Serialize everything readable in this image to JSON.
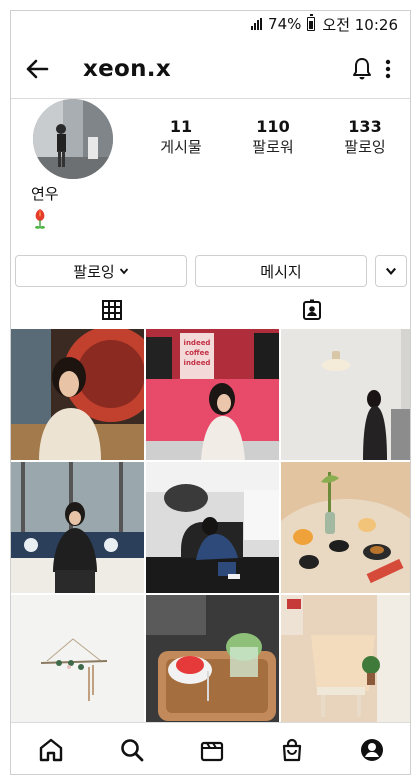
{
  "status_bar": {
    "battery": "74%",
    "time": "오전 10:26"
  },
  "header": {
    "username": "xeon.x"
  },
  "profile": {
    "display_name": "연우",
    "stats": [
      {
        "value": "11",
        "label": "게시물"
      },
      {
        "value": "110",
        "label": "팔로워"
      },
      {
        "value": "133",
        "label": "팔로잉"
      }
    ]
  },
  "actions": {
    "following_label": "팔로잉",
    "message_label": "메시지"
  },
  "grid": {
    "posts": [
      "cafe-portrait",
      "coffee-wall",
      "wall-lamp",
      "window-seat",
      "lounge-chair",
      "dessert-table",
      "wall-hanging",
      "dessert-tray",
      "sunlit-room"
    ],
    "signs": [
      "indeed",
      "coffee",
      "indeed"
    ]
  },
  "nav": [
    "home-icon",
    "search-icon",
    "reels-icon",
    "shop-icon",
    "profile-icon"
  ]
}
